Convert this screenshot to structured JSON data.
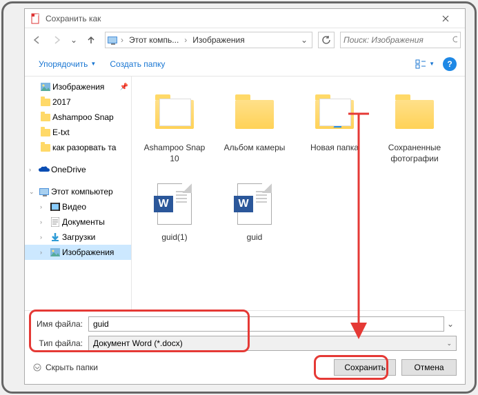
{
  "title": "Сохранить как",
  "breadcrumb": {
    "part1": "Этот компь...",
    "part2": "Изображения"
  },
  "search_placeholder": "Поиск: Изображения",
  "toolbar": {
    "organize": "Упорядочить",
    "newfolder": "Создать папку"
  },
  "tree": {
    "pictures": "Изображения",
    "y2017": "2017",
    "ashampoo": "Ashampoo Snap",
    "etxt": "E-txt",
    "razor": "как разорвать та",
    "onedrive": "OneDrive",
    "thispc": "Этот компьютер",
    "video": "Видео",
    "docs": "Документы",
    "downloads": "Загрузки",
    "images": "Изображения"
  },
  "files": {
    "f1": "Ashampoo Snap 10",
    "f2": "Альбом камеры",
    "f3": "Новая папка",
    "f4": "Сохраненные фотографии",
    "f5": "guid(1)",
    "f6": "guid"
  },
  "form": {
    "name_label": "Имя файла:",
    "name_value": "guid",
    "type_label": "Тип файла:",
    "type_value": "Документ Word (*.docx)"
  },
  "actions": {
    "hide": "Скрыть папки",
    "save": "Сохранить",
    "cancel": "Отмена"
  }
}
